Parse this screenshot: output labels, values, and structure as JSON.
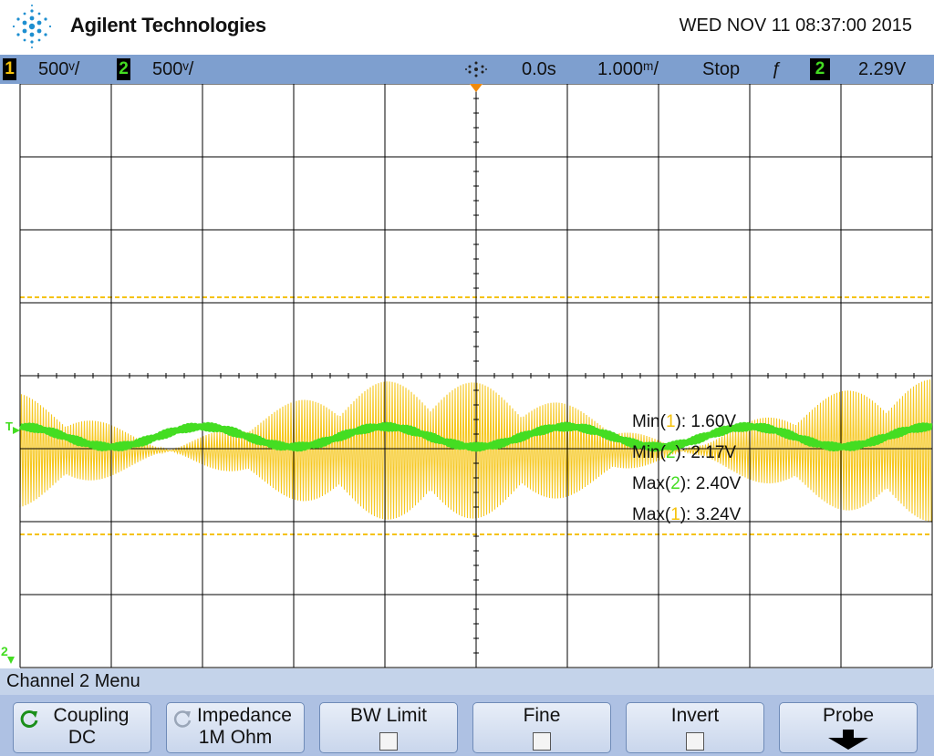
{
  "header": {
    "brand": "Agilent Technologies",
    "datetime": "WED NOV 11 08:37:00 2015"
  },
  "status": {
    "ch1_num": "1",
    "ch1_scale": "500ᵛ/",
    "ch2_num": "2",
    "ch2_scale": "500ᵛ/",
    "delay": "0.0s",
    "timebase": "1.000ᵐ/",
    "run_state": "Stop",
    "trigger_slope": "ƒ",
    "trigger_ch": "2",
    "trigger_level": "2.29V"
  },
  "markers": {
    "trigger_level": "T",
    "ch2_ground": "2"
  },
  "measurements": [
    {
      "label": "Min(",
      "ch": "1",
      "value": "): 1.60V",
      "ch_color": "c1"
    },
    {
      "label": "Min(",
      "ch": "2",
      "value": "): 2.17V",
      "ch_color": "c2"
    },
    {
      "label": "Max(",
      "ch": "2",
      "value": "): 2.40V",
      "ch_color": "c2"
    },
    {
      "label": "Max(",
      "ch": "1",
      "value": "): 3.24V",
      "ch_color": "c1"
    }
  ],
  "menu": {
    "title": "Channel 2  Menu",
    "coupling_label": "Coupling",
    "coupling_value": "DC",
    "imped_label": "Impedance",
    "imped_value": "1M Ohm",
    "bwlimit_label": "BW Limit",
    "fine_label": "Fine",
    "invert_label": "Invert",
    "probe_label": "Probe"
  },
  "colors": {
    "ch1": "#f5c20a",
    "ch2": "#44dd22",
    "status_bar": "#7e9fcf",
    "grid": "#000000"
  }
}
